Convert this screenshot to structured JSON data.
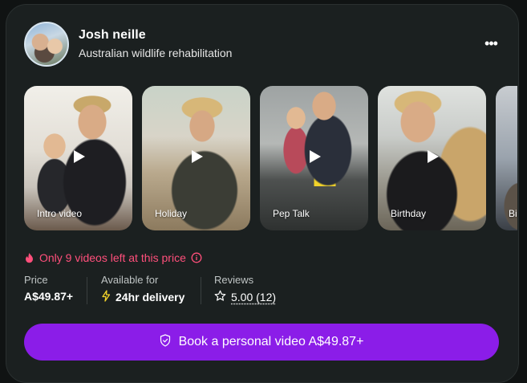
{
  "profile": {
    "name": "Josh neille",
    "subtitle": "Australian wildlife rehabilitation"
  },
  "menu_icon": "more-dots-icon",
  "videos": [
    {
      "label": "Intro video"
    },
    {
      "label": "Holiday"
    },
    {
      "label": "Pep Talk"
    },
    {
      "label": "Birthday"
    },
    {
      "label": "Bi"
    }
  ],
  "urgency": {
    "text": "Only 9 videos left at this price",
    "color": "#ff4f7b"
  },
  "stats": {
    "price_label": "Price",
    "price_value": "A$49.87+",
    "availability_label": "Available for",
    "availability_value": "24hr delivery",
    "reviews_label": "Reviews",
    "reviews_value": "5.00 (12)"
  },
  "cta": {
    "label": "Book a personal video A$49.87+",
    "color": "#8b1de8"
  }
}
